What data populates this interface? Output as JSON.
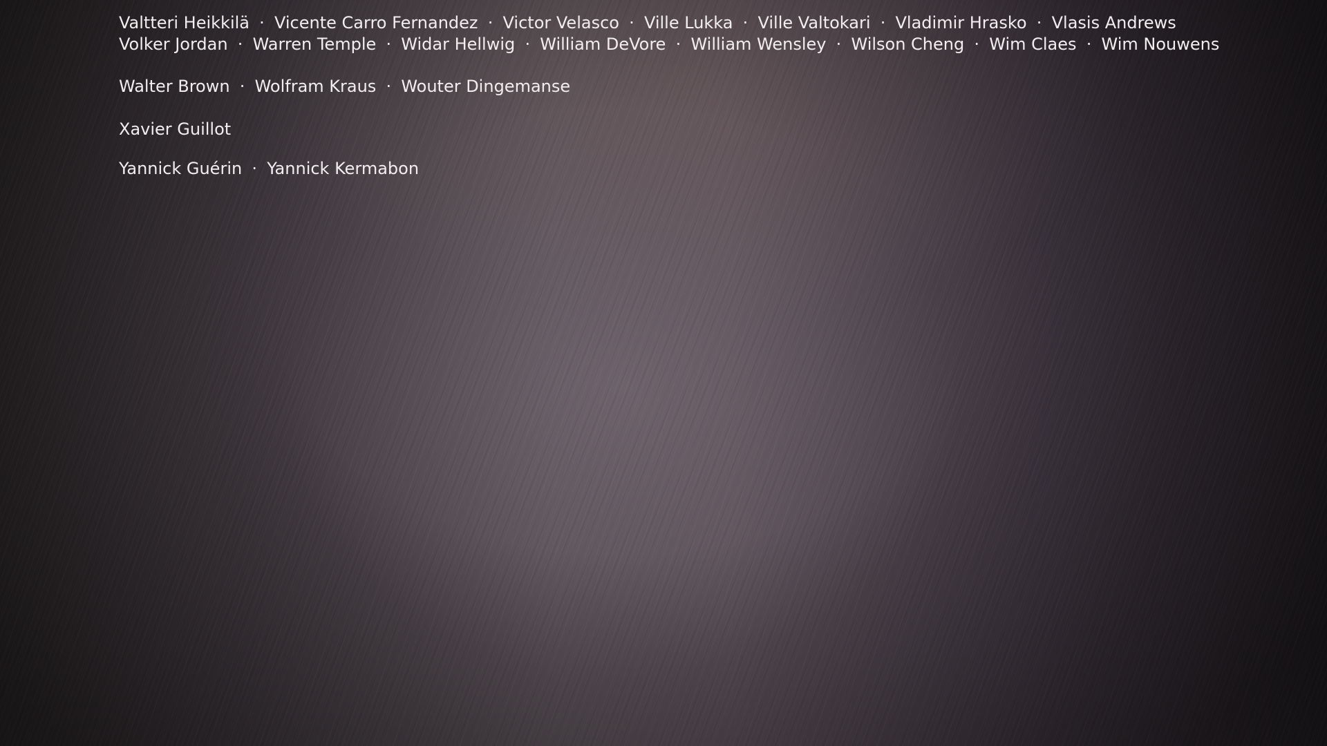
{
  "credits": {
    "group_v": {
      "line1": [
        "Valtteri Heikkilä",
        "Vicente Carro Fernandez",
        "Victor Velasco",
        "Ville Lukka",
        "Ville Valtokari",
        "Vladimir Hrasko",
        "Vlasis Andrews"
      ],
      "line2": [
        "Volker Jordan",
        "Warren Temple",
        "Widar Hellwig",
        "William DeVore",
        "William Wensley",
        "Wilson Cheng",
        "Wim Claes",
        "Wim Nouwens"
      ]
    },
    "group_w": [
      "Walter Brown",
      "Wolfram Kraus",
      "Wouter Dingemanse"
    ],
    "group_x": [
      "Xavier Guillot"
    ],
    "group_y": [
      "Yannick Guérin",
      "Yannick Kermabon"
    ],
    "separator": "·"
  }
}
